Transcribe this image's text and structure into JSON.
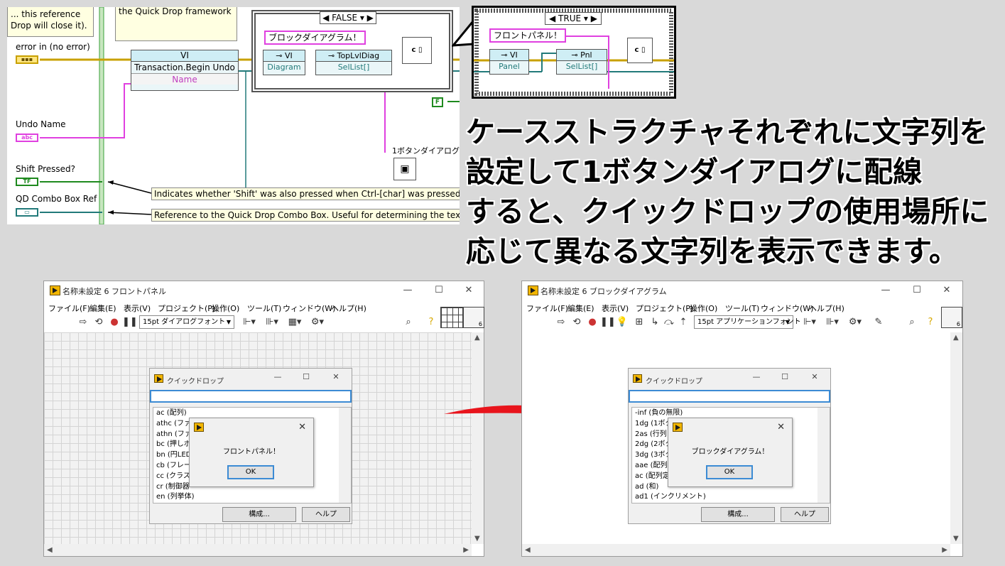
{
  "diagram": {
    "comment_box_left_lines": [
      "... this reference",
      "Drop will close it)."
    ],
    "comment_box_mid": "the Quick Drop framework",
    "error_in_label": "error in (no error)",
    "undo_name_label": "Undo Name",
    "shift_pressed_label": "Shift Pressed?",
    "qd_combo_label": "QD Combo Box Ref",
    "vi_node_label": "VI",
    "transaction_node_label": "Transaction.Begin Undo",
    "name_property_label": "Name",
    "false_case_label": "FALSE",
    "false_string": "ブロックダイアグラム！",
    "vi_class_label": "VI",
    "diagram_property": "Diagram",
    "toplvldiag_label": "TopLvlDiag",
    "sellist_label": "SelList[]",
    "one_button_label": "1ボタンダイアログ",
    "tooltip_shift": "Indicates whether 'Shift' was also pressed when Ctrl-[char] was pressed.",
    "tooltip_ref": "Reference to the Quick Drop Combo Box.  Useful for determining the text c",
    "false_const": "F"
  },
  "true_case": {
    "case_label": "TRUE",
    "string": "フロントパネル！",
    "vi_label": "VI",
    "panel_property": "Panel",
    "pnl_label": "Pnl",
    "sellist_label": "SelList[]"
  },
  "headline": {
    "lines": [
      "ケースストラクチャそれぞれに文字列を",
      "設定して1ボタンダイアログに配線",
      "すると、クイックドロップの使用場所に",
      "応じて異なる文字列を表示できます。"
    ]
  },
  "front_panel_window": {
    "title": "名称未設定 6 フロントパネル",
    "menu": [
      "ファイル(F)",
      "編集(E)",
      "表示(V)",
      "プロジェクト(P)",
      "操作(O)",
      "ツール(T)",
      "ウィンドウ(W)",
      "ヘルプ(H)"
    ],
    "font_select": "15pt ダイアログフォント",
    "vi_number": "6",
    "quickdrop": {
      "title": "クイックドロップ",
      "items": [
        "ac (配列)",
        "athc (ファイ",
        "athn (ファイ",
        "bc (押しボ",
        "bn (円LED",
        "cb (フレーム",
        "cc (クラスタ",
        "cr (制御器",
        "en (列挙体)"
      ],
      "configure_button": "構成...",
      "help_button": "ヘルプ"
    },
    "message": {
      "text": "フロントパネル！",
      "ok": "OK"
    }
  },
  "block_diagram_window": {
    "title": "名称未設定 6 ブロックダイアグラム",
    "menu": [
      "ファイル(F)",
      "編集(E)",
      "表示(V)",
      "プロジェクト(P)",
      "操作(O)",
      "ツール(T)",
      "ウィンドウ(W)",
      "ヘルプ(H)"
    ],
    "font_select": "15pt アプリケーションフォント",
    "vi_number": "6",
    "quickdrop": {
      "title": "クイックドロップ",
      "items": [
        "-inf (負の無限)",
        "1dg (1ボタ",
        "2as (行列",
        "2dg (2ボタ",
        "3dg (3ボタ",
        "aae (配列",
        "ac (配列定",
        "ad (和)",
        "ad1 (インクリメント)"
      ],
      "configure_button": "構成...",
      "help_button": "ヘルプ"
    },
    "message": {
      "text": "ブロックダイアグラム！",
      "ok": "OK"
    }
  },
  "colors": {
    "string_wire": "#e040e0",
    "ref_wire": "#227a7a",
    "error_wire": "#c8a000",
    "bool_wire": "#1f8a1f",
    "arrow": "#e8141c",
    "labview_yellow": "#f2b600"
  }
}
